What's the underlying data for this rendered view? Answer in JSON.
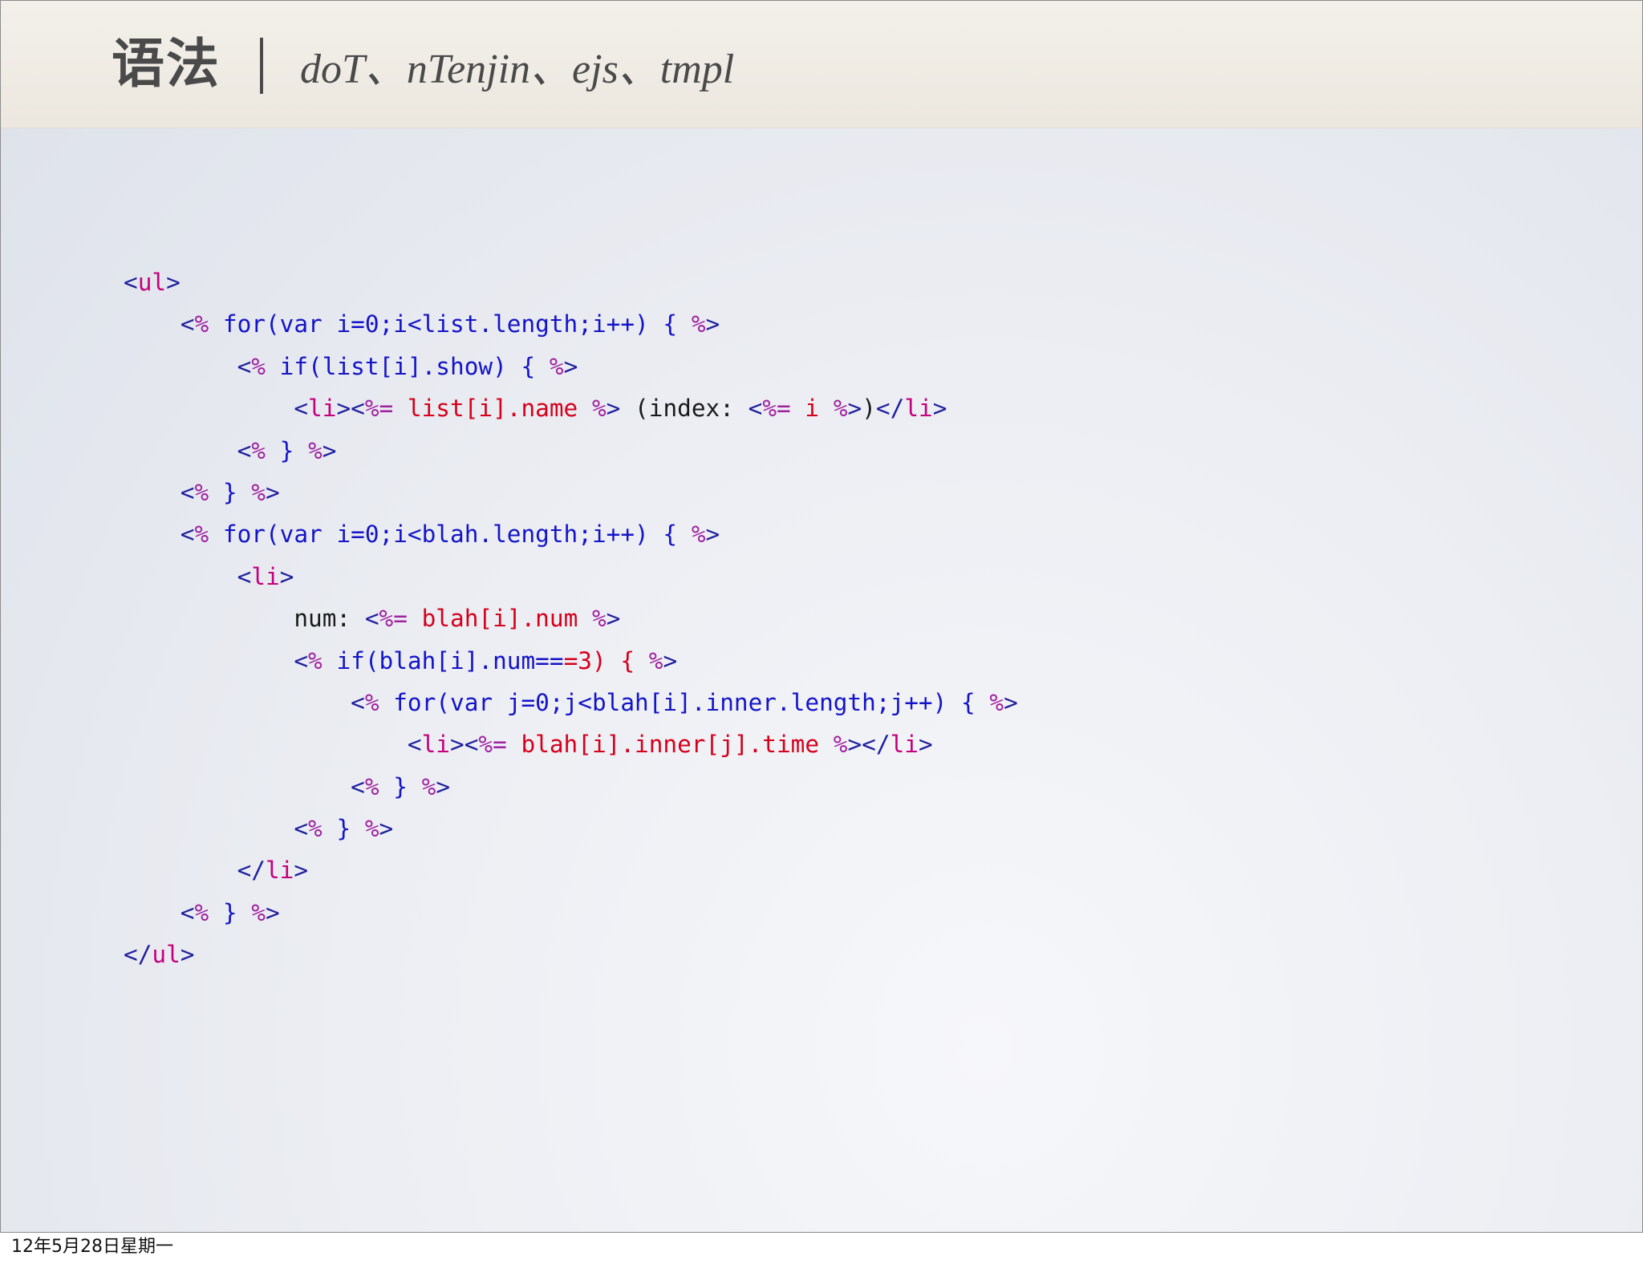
{
  "slide": {
    "title": "语法",
    "separator": "|",
    "subtitle": "doT、nTenjin、ejs、tmpl"
  },
  "code": {
    "lines": [
      {
        "indent": 0,
        "tokens": [
          {
            "t": "tag",
            "v": "<"
          },
          {
            "t": "tagname",
            "v": "ul"
          },
          {
            "t": "tag",
            "v": ">"
          }
        ]
      },
      {
        "indent": 1,
        "tokens": [
          {
            "t": "tag",
            "v": "<"
          },
          {
            "t": "delim",
            "v": "%"
          },
          {
            "t": "kw",
            "v": " for(var i=0;i<list.length;i++) { "
          },
          {
            "t": "delim",
            "v": "%"
          },
          {
            "t": "tag",
            "v": ">"
          }
        ]
      },
      {
        "indent": 2,
        "tokens": [
          {
            "t": "tag",
            "v": "<"
          },
          {
            "t": "delim",
            "v": "%"
          },
          {
            "t": "kw",
            "v": " if(list[i].show) { "
          },
          {
            "t": "delim",
            "v": "%"
          },
          {
            "t": "tag",
            "v": ">"
          }
        ]
      },
      {
        "indent": 3,
        "tokens": [
          {
            "t": "tag",
            "v": "<"
          },
          {
            "t": "tagname",
            "v": "li"
          },
          {
            "t": "tag",
            "v": "><"
          },
          {
            "t": "delim",
            "v": "%="
          },
          {
            "t": "expr",
            "v": " list[i].name "
          },
          {
            "t": "delim",
            "v": "%"
          },
          {
            "t": "tag",
            "v": ">"
          },
          {
            "t": "text",
            "v": " (index: "
          },
          {
            "t": "tag",
            "v": "<"
          },
          {
            "t": "delim",
            "v": "%="
          },
          {
            "t": "expr",
            "v": " i "
          },
          {
            "t": "delim",
            "v": "%"
          },
          {
            "t": "tag",
            "v": ">"
          },
          {
            "t": "text",
            "v": ")"
          },
          {
            "t": "tag",
            "v": "</"
          },
          {
            "t": "tagname",
            "v": "li"
          },
          {
            "t": "tag",
            "v": ">"
          }
        ]
      },
      {
        "indent": 2,
        "tokens": [
          {
            "t": "tag",
            "v": "<"
          },
          {
            "t": "delim",
            "v": "%"
          },
          {
            "t": "kw",
            "v": " } "
          },
          {
            "t": "delim",
            "v": "%"
          },
          {
            "t": "tag",
            "v": ">"
          }
        ]
      },
      {
        "indent": 1,
        "tokens": [
          {
            "t": "tag",
            "v": "<"
          },
          {
            "t": "delim",
            "v": "%"
          },
          {
            "t": "kw",
            "v": " } "
          },
          {
            "t": "delim",
            "v": "%"
          },
          {
            "t": "tag",
            "v": ">"
          }
        ]
      },
      {
        "indent": 1,
        "tokens": [
          {
            "t": "tag",
            "v": "<"
          },
          {
            "t": "delim",
            "v": "%"
          },
          {
            "t": "kw",
            "v": " for(var i=0;i<blah.length;i++) { "
          },
          {
            "t": "delim",
            "v": "%"
          },
          {
            "t": "tag",
            "v": ">"
          }
        ]
      },
      {
        "indent": 2,
        "tokens": [
          {
            "t": "tag",
            "v": "<"
          },
          {
            "t": "tagname",
            "v": "li"
          },
          {
            "t": "tag",
            "v": ">"
          }
        ]
      },
      {
        "indent": 3,
        "tokens": [
          {
            "t": "text",
            "v": "num: "
          },
          {
            "t": "tag",
            "v": "<"
          },
          {
            "t": "delim",
            "v": "%="
          },
          {
            "t": "expr",
            "v": " blah[i].num "
          },
          {
            "t": "delim",
            "v": "%"
          },
          {
            "t": "tag",
            "v": ">"
          }
        ]
      },
      {
        "indent": 3,
        "tokens": [
          {
            "t": "tag",
            "v": "<"
          },
          {
            "t": "delim",
            "v": "%"
          },
          {
            "t": "kw",
            "v": " if(blah[i].num=="
          },
          {
            "t": "expr",
            "v": "=3) { "
          },
          {
            "t": "delim",
            "v": "%"
          },
          {
            "t": "tag",
            "v": ">"
          }
        ]
      },
      {
        "indent": 4,
        "tokens": [
          {
            "t": "tag",
            "v": "<"
          },
          {
            "t": "delim",
            "v": "%"
          },
          {
            "t": "kw",
            "v": " for(var j=0;j<blah[i].inner.length;j++) { "
          },
          {
            "t": "delim",
            "v": "%"
          },
          {
            "t": "tag",
            "v": ">"
          }
        ]
      },
      {
        "indent": 5,
        "tokens": [
          {
            "t": "tag",
            "v": "<"
          },
          {
            "t": "tagname",
            "v": "li"
          },
          {
            "t": "tag",
            "v": "><"
          },
          {
            "t": "delim",
            "v": "%="
          },
          {
            "t": "expr",
            "v": " blah[i].inner[j].time "
          },
          {
            "t": "delim",
            "v": "%"
          },
          {
            "t": "tag",
            "v": "></"
          },
          {
            "t": "tagname",
            "v": "li"
          },
          {
            "t": "tag",
            "v": ">"
          }
        ]
      },
      {
        "indent": 4,
        "tokens": [
          {
            "t": "tag",
            "v": "<"
          },
          {
            "t": "delim",
            "v": "%"
          },
          {
            "t": "kw",
            "v": " } "
          },
          {
            "t": "delim",
            "v": "%"
          },
          {
            "t": "tag",
            "v": ">"
          }
        ]
      },
      {
        "indent": 3,
        "tokens": [
          {
            "t": "tag",
            "v": "<"
          },
          {
            "t": "delim",
            "v": "%"
          },
          {
            "t": "kw",
            "v": " } "
          },
          {
            "t": "delim",
            "v": "%"
          },
          {
            "t": "tag",
            "v": ">"
          }
        ]
      },
      {
        "indent": 2,
        "tokens": [
          {
            "t": "tag",
            "v": "</"
          },
          {
            "t": "tagname",
            "v": "li"
          },
          {
            "t": "tag",
            "v": ">"
          }
        ]
      },
      {
        "indent": 1,
        "tokens": [
          {
            "t": "tag",
            "v": "<"
          },
          {
            "t": "delim",
            "v": "%"
          },
          {
            "t": "kw",
            "v": " } "
          },
          {
            "t": "delim",
            "v": "%"
          },
          {
            "t": "tag",
            "v": ">"
          }
        ]
      },
      {
        "indent": 0,
        "tokens": [
          {
            "t": "tag",
            "v": "</"
          },
          {
            "t": "tagname",
            "v": "ul"
          },
          {
            "t": "tag",
            "v": ">"
          }
        ]
      }
    ]
  },
  "footer": {
    "date": "12年5月28日星期一"
  },
  "colors": {
    "tag": "#1f1f9e",
    "tagname": "#c5007c",
    "delim": "#a020a0",
    "keyword": "#1414c8",
    "expression": "#d6001c",
    "text": "#1a1a1a",
    "title": "#4a4a4a"
  }
}
